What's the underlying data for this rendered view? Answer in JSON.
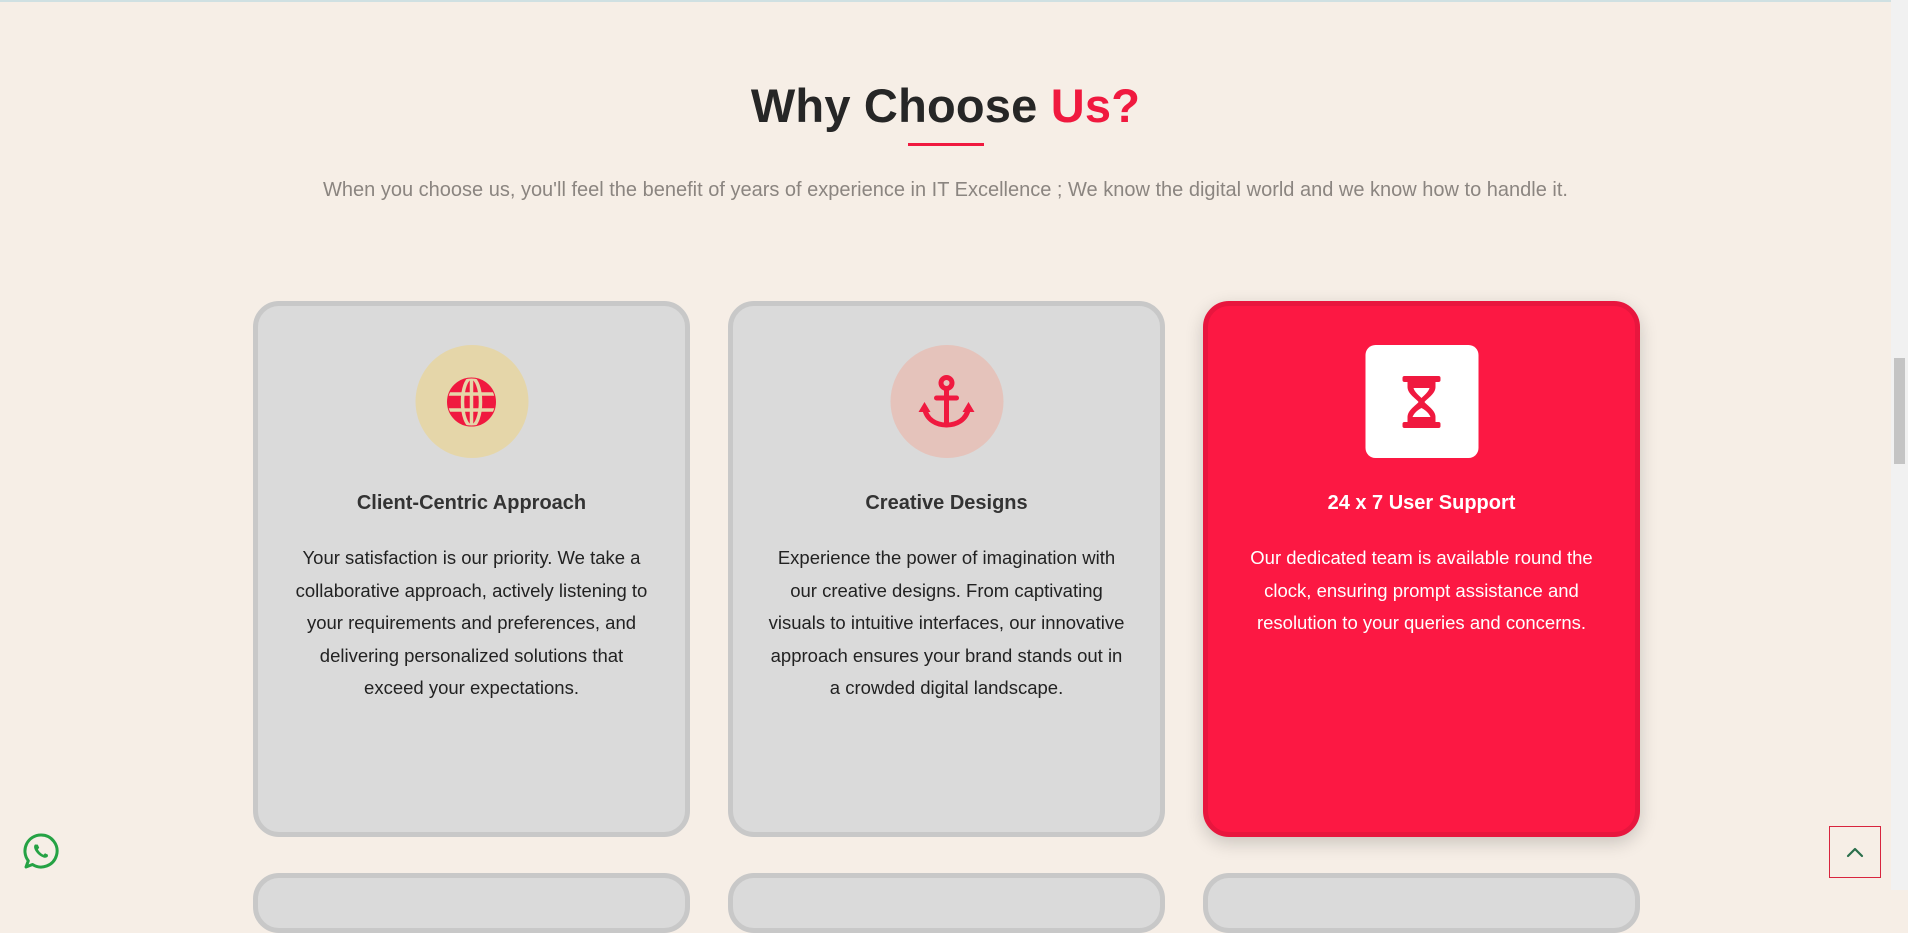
{
  "section": {
    "title_main": "Why Choose ",
    "title_accent": "Us?",
    "subtitle": "When you choose us, you'll feel the benefit of years of experience in IT Excellence ; We know the digital world and we know how to handle it."
  },
  "colors": {
    "accent": "#f0193f",
    "background": "#f6eee6",
    "card": "#dadada",
    "card_active": "#fc1843"
  },
  "cards": [
    {
      "icon": "globe-icon",
      "title": "Client-Centric Approach",
      "description": "Your satisfaction is our priority. We take a collaborative approach, actively listening to your requirements and preferences, and delivering personalized solutions that exceed your expectations."
    },
    {
      "icon": "anchor-icon",
      "title": "Creative Designs",
      "description": "Experience the power of imagination with our creative designs. From captivating visuals to intuitive interfaces, our innovative approach ensures your brand stands out in a crowded digital landscape."
    },
    {
      "icon": "hourglass-icon",
      "title": "24 x 7 User Support",
      "description": "Our dedicated team is available round the clock, ensuring prompt assistance and resolution to your queries and concerns."
    }
  ],
  "floating": {
    "whatsapp_icon": "whatsapp-icon",
    "back_to_top_icon": "chevron-up-icon"
  }
}
